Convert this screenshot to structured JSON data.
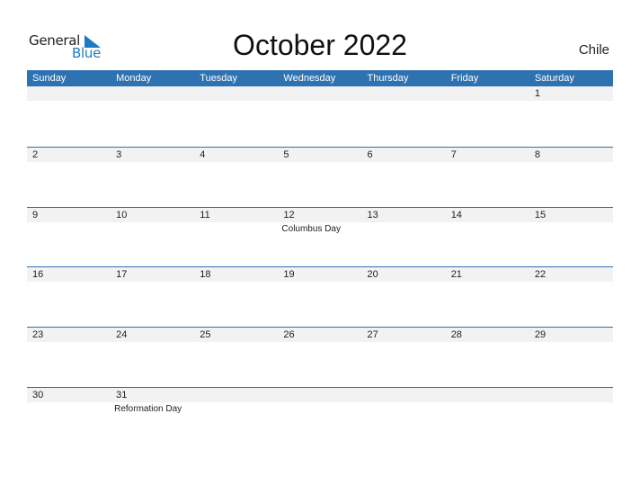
{
  "logo": {
    "word1": "General",
    "word2": "Blue"
  },
  "title": "October 2022",
  "country": "Chile",
  "colors": {
    "accent": "#2e72b2",
    "strip": "#f2f2f2"
  },
  "weekdays": [
    "Sunday",
    "Monday",
    "Tuesday",
    "Wednesday",
    "Thursday",
    "Friday",
    "Saturday"
  ],
  "weeks": [
    {
      "days": [
        "",
        "",
        "",
        "",
        "",
        "",
        "1"
      ],
      "holidays": [
        "",
        "",
        "",
        "",
        "",
        "",
        ""
      ]
    },
    {
      "days": [
        "2",
        "3",
        "4",
        "5",
        "6",
        "7",
        "8"
      ],
      "holidays": [
        "",
        "",
        "",
        "",
        "",
        "",
        ""
      ]
    },
    {
      "days": [
        "9",
        "10",
        "11",
        "12",
        "13",
        "14",
        "15"
      ],
      "holidays": [
        "",
        "",
        "",
        "Columbus Day",
        "",
        "",
        ""
      ]
    },
    {
      "days": [
        "16",
        "17",
        "18",
        "19",
        "20",
        "21",
        "22"
      ],
      "holidays": [
        "",
        "",
        "",
        "",
        "",
        "",
        ""
      ]
    },
    {
      "days": [
        "23",
        "24",
        "25",
        "26",
        "27",
        "28",
        "29"
      ],
      "holidays": [
        "",
        "",
        "",
        "",
        "",
        "",
        ""
      ]
    },
    {
      "days": [
        "30",
        "31",
        "",
        "",
        "",
        "",
        ""
      ],
      "holidays": [
        "",
        "Reformation Day",
        "",
        "",
        "",
        "",
        ""
      ]
    }
  ]
}
